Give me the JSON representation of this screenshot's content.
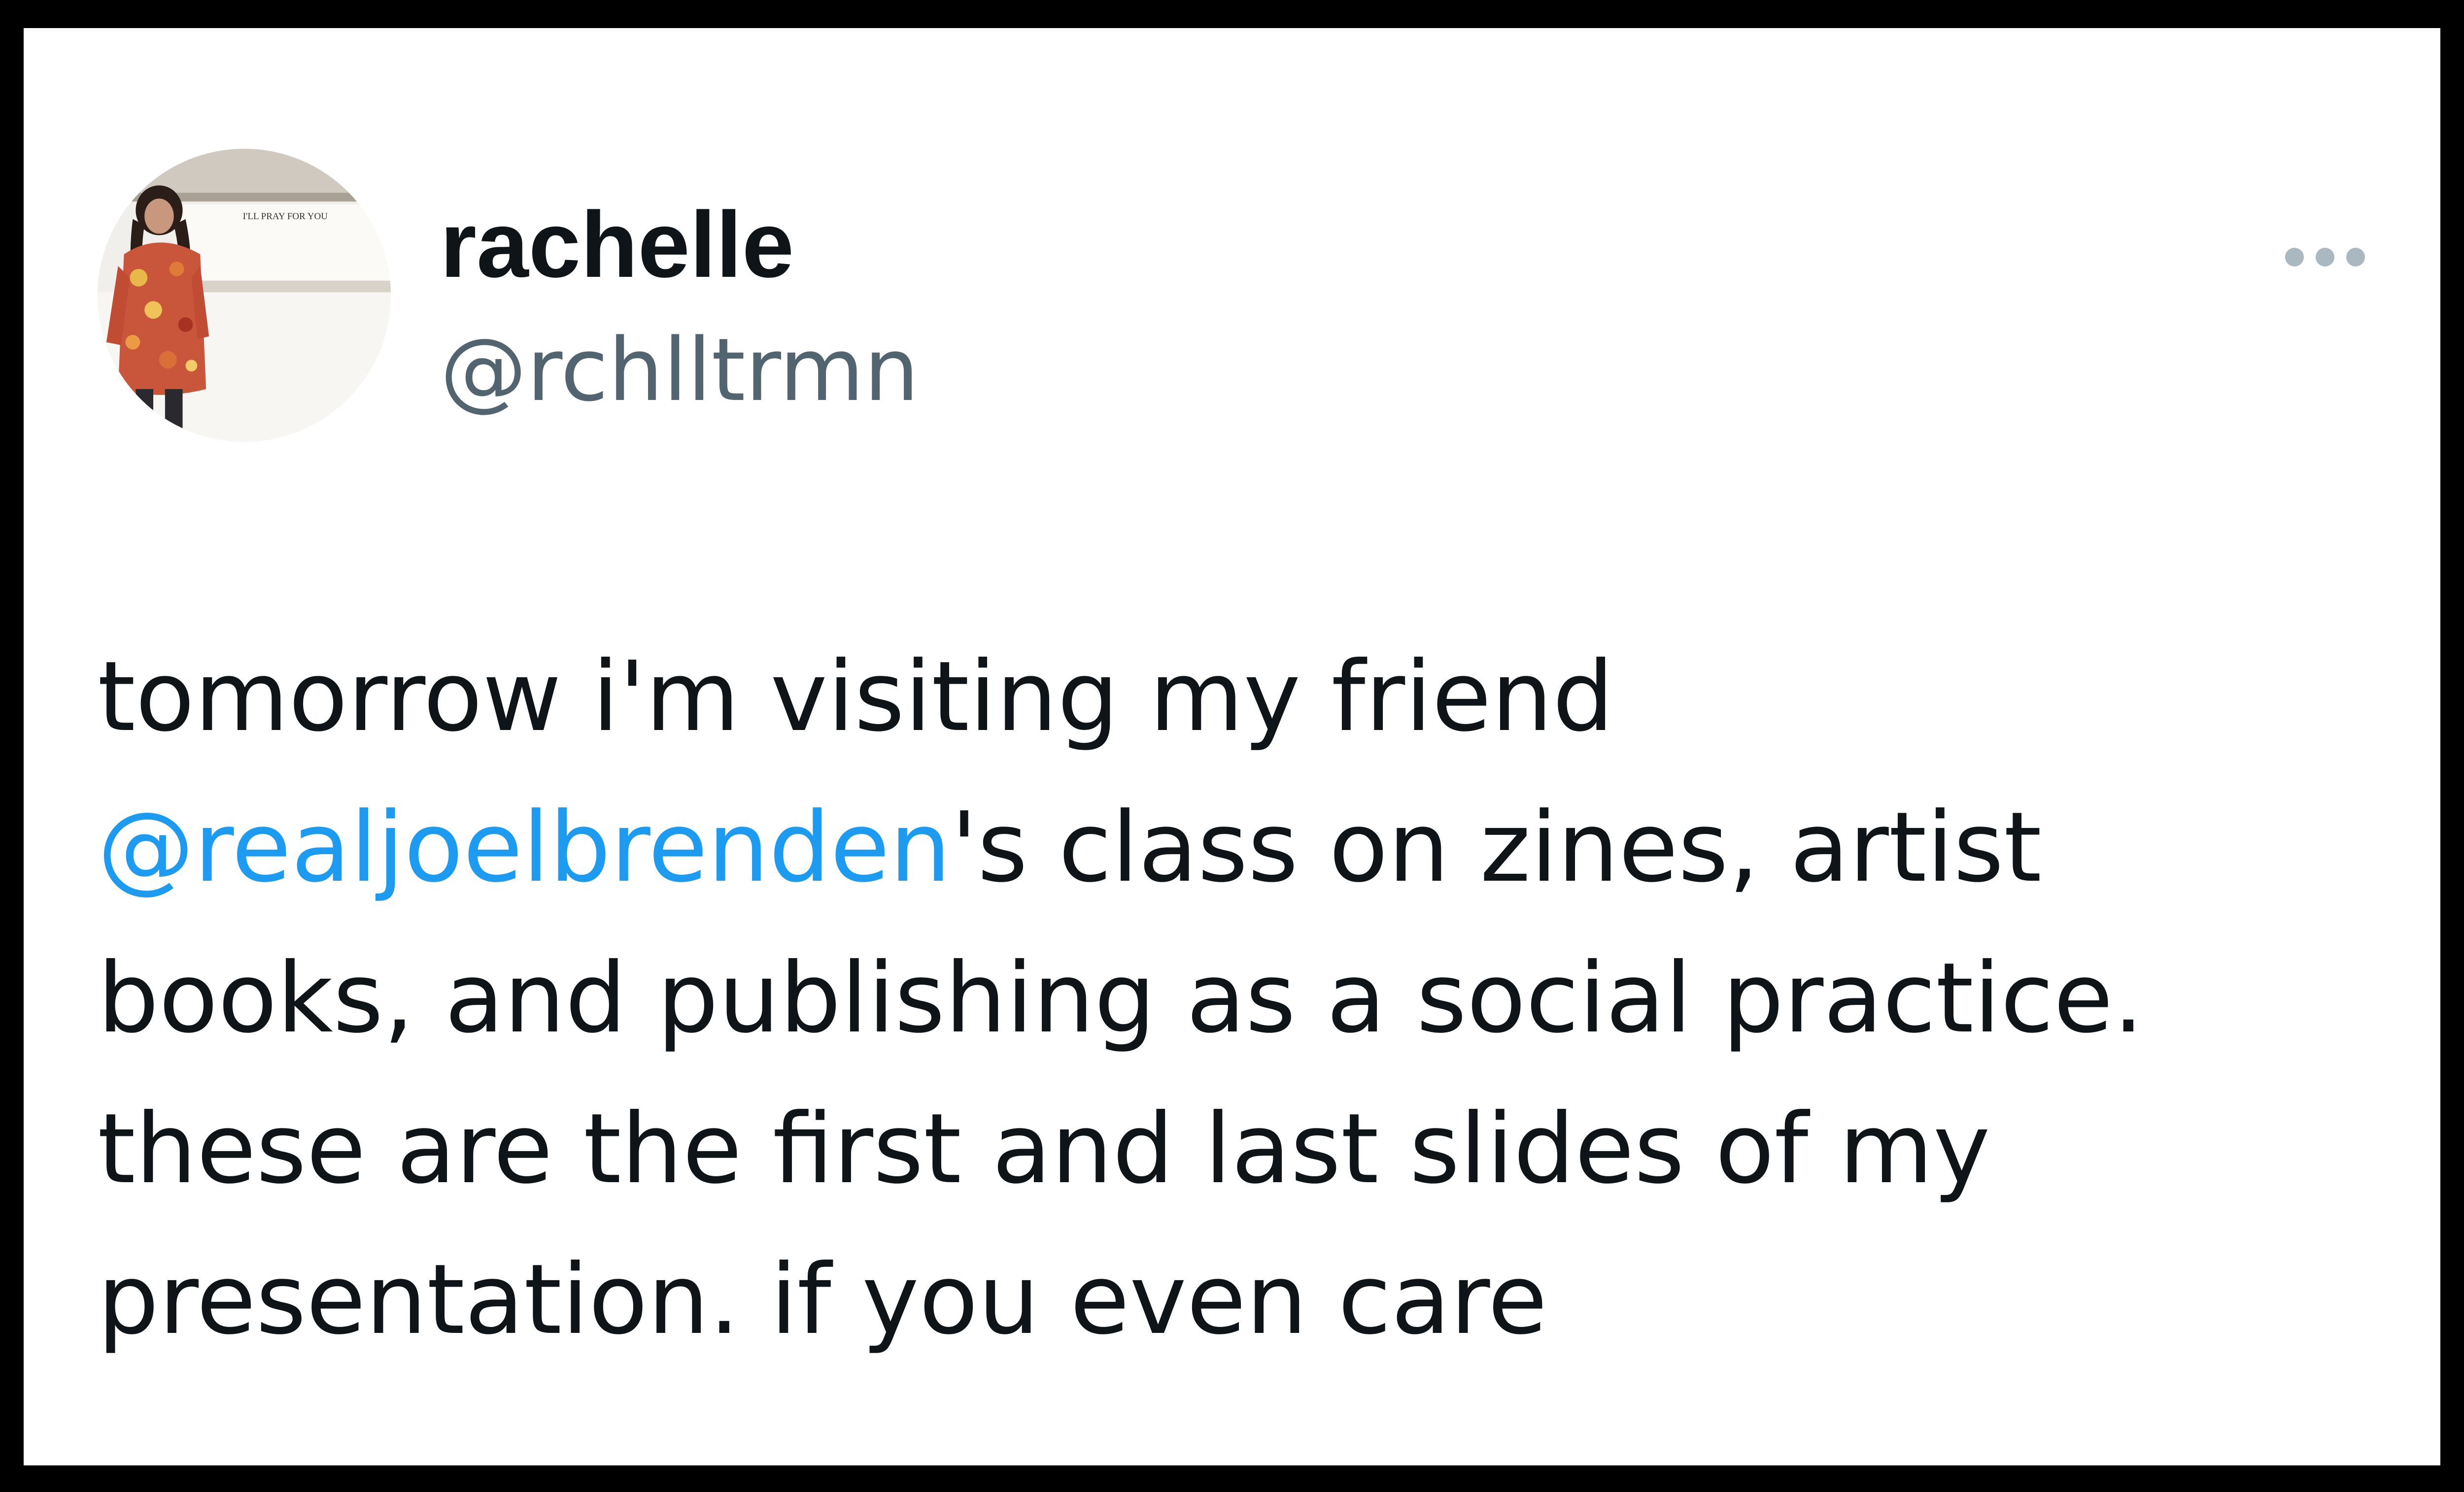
{
  "tweet": {
    "author": {
      "display_name": "rachelle",
      "handle": "@rchlltrmn",
      "avatar_sign_text": "I'LL PRAY FOR YOU"
    },
    "more_menu_icon": "more-horizontal-icon",
    "text": {
      "line1": "tomorrow i'm visiting my friend",
      "mention": "@realjoelbrenden",
      "after_mention": "'s class on zines, artist",
      "line3": "books, and publishing as a social practice.",
      "line4": "these are the first and last slides of my",
      "line5": "presentation. if you even care"
    }
  },
  "colors": {
    "text_primary": "#0f1419",
    "text_secondary": "#536471",
    "mention_link": "#1d9bf0",
    "more_icon": "#aab8c2",
    "frame_border": "#000000",
    "card_background": "#ffffff"
  }
}
